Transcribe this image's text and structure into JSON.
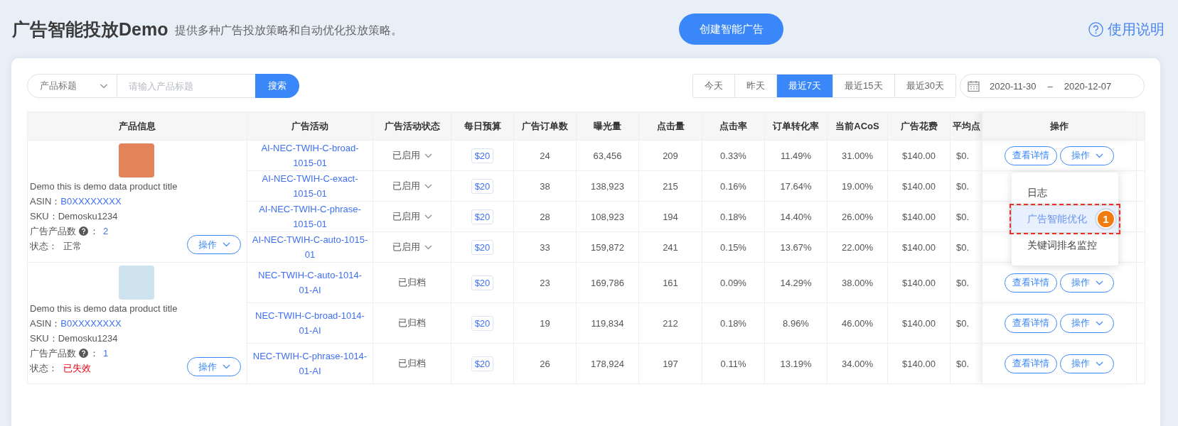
{
  "header": {
    "title": "广告智能投放Demo",
    "subtitle": "提供多种广告投放策略和自动优化投放策略。",
    "create_button": "创建智能广告",
    "help_link": "使用说明"
  },
  "search": {
    "field_select": "产品标题",
    "placeholder": "请输入产品标题",
    "button": "搜索"
  },
  "date_ranges": [
    {
      "label": "今天",
      "selected": false
    },
    {
      "label": "昨天",
      "selected": false
    },
    {
      "label": "最近7天",
      "selected": true
    },
    {
      "label": "最近15天",
      "selected": false
    },
    {
      "label": "最近30天",
      "selected": false
    }
  ],
  "date_picker": {
    "start": "2020-11-30",
    "separator": "–",
    "end": "2020-12-07"
  },
  "table": {
    "columns": [
      "产品信息",
      "广告活动",
      "广告活动状态",
      "每日预算",
      "广告订单数",
      "曝光量",
      "点击量",
      "点击率",
      "订单转化率",
      "当前ACoS",
      "广告花费",
      "平均点",
      "操作"
    ],
    "products": [
      {
        "title": "Demo this is demo data product title",
        "asin_label": "ASIN：",
        "asin": "B0XXXXXXXX",
        "sku": "SKU：Demosku1234",
        "ad_count_label": "广告产品数",
        "colon": "：",
        "ad_count": "2",
        "status_label": "状态：",
        "status": "正常",
        "kind": "normal",
        "action": "操作",
        "campaigns": [
          {
            "name": "AI-NEC-TWIH-C-broad-1015-01",
            "status": "已启用",
            "kind": "enabled",
            "budget": "$20",
            "orders": "24",
            "impressions": "63,456",
            "clicks": "209",
            "ctr": "0.33%",
            "cvr": "11.49%",
            "acos": "31.00%",
            "spend": "$140.00",
            "avg": "$0.",
            "details": "查看详情",
            "action": "操作"
          },
          {
            "name": "AI-NEC-TWIH-C-exact-1015-01",
            "status": "已启用",
            "kind": "enabled",
            "budget": "$20",
            "orders": "38",
            "impressions": "138,923",
            "clicks": "215",
            "ctr": "0.16%",
            "cvr": "17.64%",
            "acos": "19.00%",
            "spend": "$140.00",
            "avg": "$0."
          },
          {
            "name": "AI-NEC-TWIH-C-phrase-1015-01",
            "status": "已启用",
            "kind": "enabled",
            "budget": "$20",
            "orders": "28",
            "impressions": "108,923",
            "clicks": "194",
            "ctr": "0.18%",
            "cvr": "14.40%",
            "acos": "26.00%",
            "spend": "$140.00",
            "avg": "$0."
          },
          {
            "name": "AI-NEC-TWIH-C-auto-1015-01",
            "status": "已启用",
            "kind": "enabled",
            "budget": "$20",
            "orders": "33",
            "impressions": "159,872",
            "clicks": "241",
            "ctr": "0.15%",
            "cvr": "13.67%",
            "acos": "22.00%",
            "spend": "$140.00",
            "avg": "$0."
          }
        ]
      },
      {
        "title": "Demo this is demo data product title",
        "asin_label": "ASIN：",
        "asin": "B0XXXXXXXX",
        "sku": "SKU：Demosku1234",
        "ad_count_label": "广告产品数",
        "colon": "：",
        "ad_count": "1",
        "status_label": "状态：",
        "status": "已失效",
        "kind": "expired",
        "action": "操作",
        "campaigns": [
          {
            "name": "NEC-TWIH-C-auto-1014-01-AI",
            "status": "已归档",
            "kind": "archived",
            "budget": "$20",
            "orders": "23",
            "impressions": "169,786",
            "clicks": "161",
            "ctr": "0.09%",
            "cvr": "14.29%",
            "acos": "38.00%",
            "spend": "$140.00",
            "avg": "$0.",
            "details": "查看详情",
            "action": "操作"
          },
          {
            "name": "NEC-TWIH-C-broad-1014-01-AI",
            "status": "已归档",
            "kind": "archived",
            "budget": "$20",
            "orders": "19",
            "impressions": "119,834",
            "clicks": "212",
            "ctr": "0.18%",
            "cvr": "8.96%",
            "acos": "46.00%",
            "spend": "$140.00",
            "avg": "$0.",
            "details": "查看详情",
            "action": "操作"
          },
          {
            "name": "NEC-TWIH-C-phrase-1014-01-AI",
            "status": "已归档",
            "kind": "archived",
            "budget": "$20",
            "orders": "26",
            "impressions": "178,924",
            "clicks": "197",
            "ctr": "0.11%",
            "cvr": "13.19%",
            "acos": "34.00%",
            "spend": "$140.00",
            "avg": "$0.",
            "details": "查看详情",
            "action": "操作"
          }
        ]
      }
    ]
  },
  "menu": {
    "items": [
      {
        "label": "日志",
        "selected": false
      },
      {
        "label": "广告智能优化",
        "selected": true,
        "marker": "1"
      },
      {
        "label": "关键词排名监控",
        "selected": false
      }
    ]
  }
}
